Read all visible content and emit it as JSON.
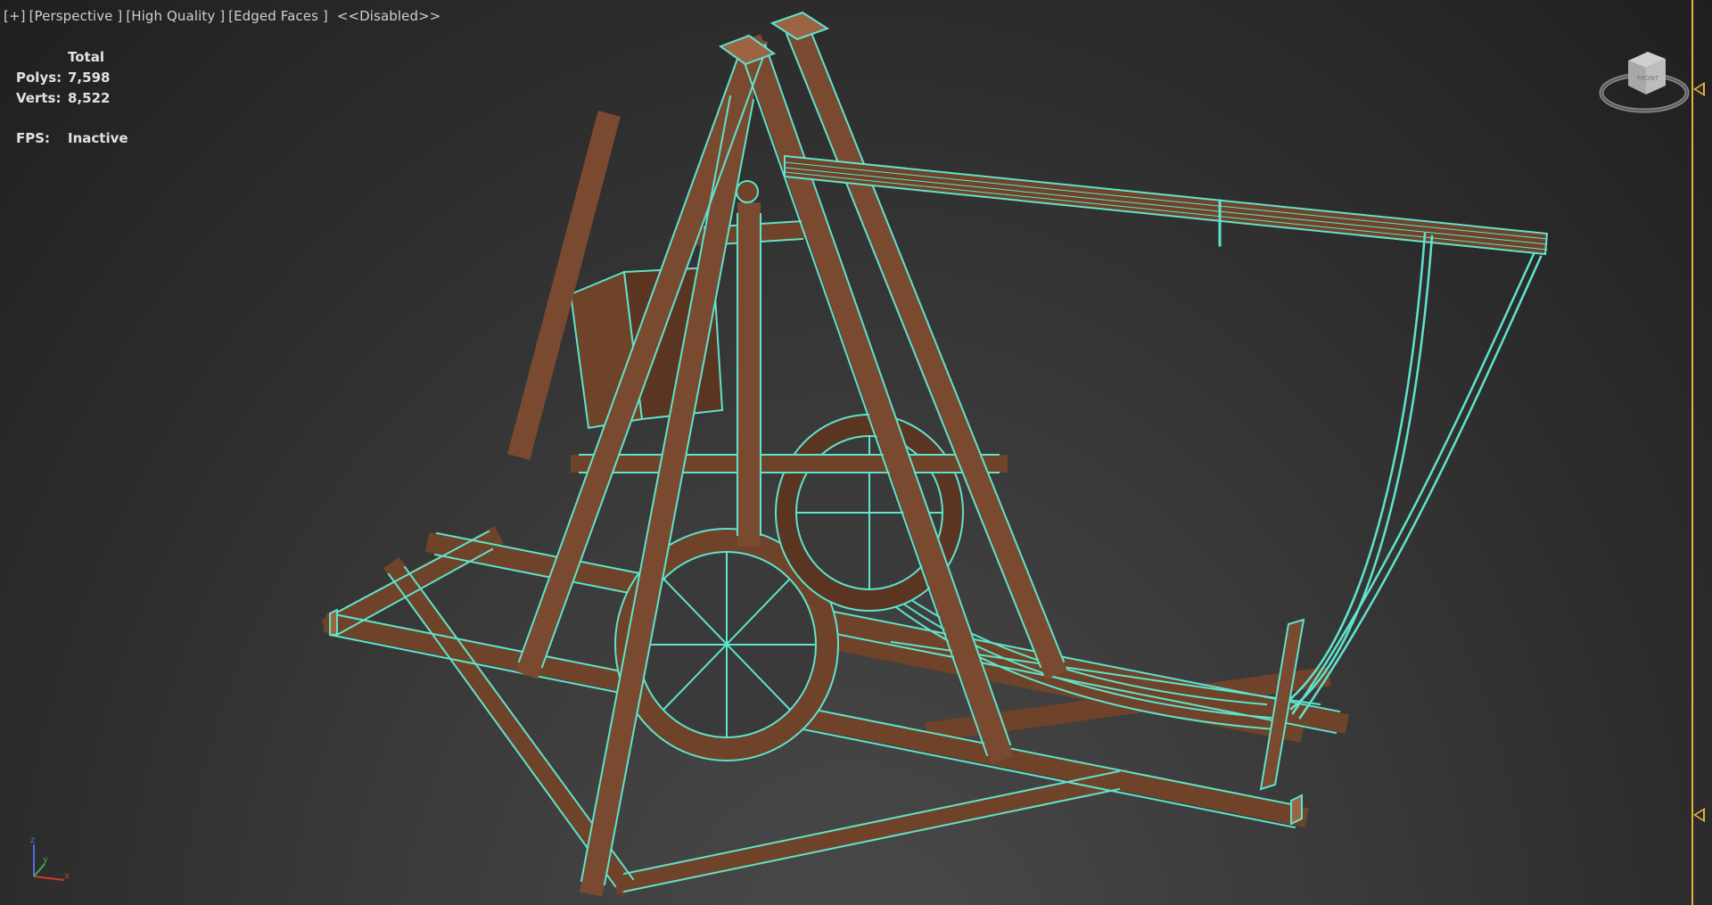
{
  "viewport": {
    "menu": {
      "plus": "[+]",
      "view": "[Perspective ]",
      "quality": "[High Quality ]",
      "shading": "[Edged Faces ]",
      "status": "<<Disabled>>"
    },
    "stats": {
      "header": "Total",
      "polys_label": "Polys:",
      "polys_value": "7,598",
      "verts_label": "Verts:",
      "verts_value": "8,522",
      "fps_label": "FPS:",
      "fps_value": "Inactive"
    },
    "viewcube_label": "FRONT",
    "axis_labels": {
      "z": "z",
      "y": "y",
      "x": "x"
    }
  },
  "colors": {
    "wireframe": "#5fe3cc",
    "wood": "#7a4a30",
    "wood_light": "#9c6443",
    "accent": "#e4b43c"
  },
  "scene_object": "trebuchet-model"
}
